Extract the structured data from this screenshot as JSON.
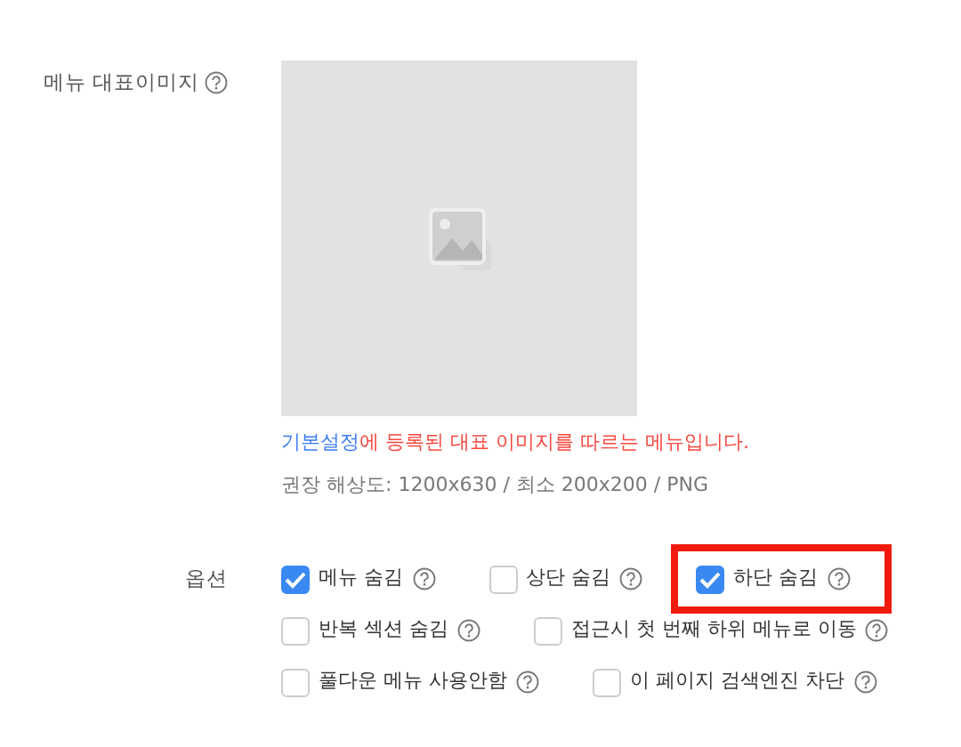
{
  "image_field": {
    "label": "메뉴 대표이미지",
    "note_link": "기본설정",
    "note_text": "에 등록된 대표 이미지를 따르는 메뉴입니다.",
    "hint": "권장 해상도: 1200x630 / 최소 200x200 / PNG"
  },
  "options": {
    "label": "옵션",
    "rows": [
      [
        {
          "label": "메뉴 숨김",
          "checked": true,
          "highlighted": false
        },
        {
          "label": "상단 숨김",
          "checked": false,
          "highlighted": false
        },
        {
          "label": "하단 숨김",
          "checked": true,
          "highlighted": true
        }
      ],
      [
        {
          "label": "반복 섹션 숨김",
          "checked": false,
          "highlighted": false
        },
        {
          "label": "접근시 첫 번째 하위 메뉴로 이동",
          "checked": false,
          "highlighted": false
        }
      ],
      [
        {
          "label": "풀다운 메뉴 사용안함",
          "checked": false,
          "highlighted": false
        },
        {
          "label": "이 페이지 검색엔진 차단",
          "checked": false,
          "highlighted": false
        }
      ]
    ]
  }
}
